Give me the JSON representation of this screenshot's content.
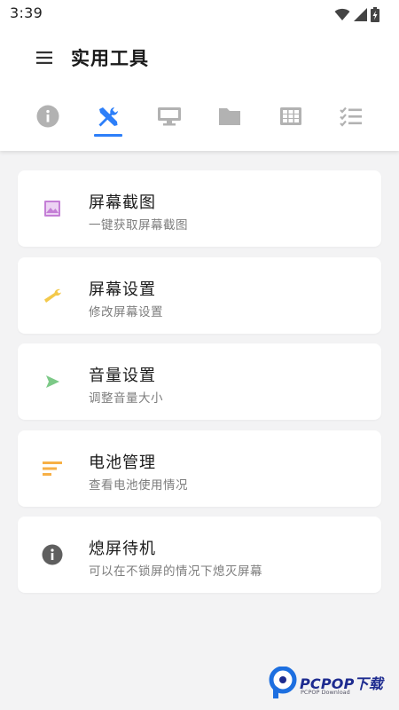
{
  "status_bar": {
    "time": "3:39",
    "icons": [
      "wifi-icon",
      "signal-icon",
      "battery-charging-icon"
    ]
  },
  "app_bar": {
    "menu_icon": "menu-icon",
    "title": "实用工具"
  },
  "tabs": [
    {
      "icon": "info-icon",
      "selected": false
    },
    {
      "icon": "tools-icon",
      "selected": true
    },
    {
      "icon": "monitor-icon",
      "selected": false
    },
    {
      "icon": "folder-icon",
      "selected": false
    },
    {
      "icon": "grid-icon",
      "selected": false
    },
    {
      "icon": "checklist-icon",
      "selected": false
    }
  ],
  "colors": {
    "accent": "#2d7ff9",
    "tab_inactive": "#b2b2b2",
    "screenshot_icon": "#c47fd6",
    "wrench_icon": "#f3c94b",
    "volume_icon": "#7cc987",
    "battery_icon": "#f7b046",
    "info_icon": "#5f5f5f"
  },
  "items": [
    {
      "icon": "image-icon",
      "title": "屏幕截图",
      "subtitle": "一键获取屏幕截图"
    },
    {
      "icon": "wrench-icon",
      "title": "屏幕设置",
      "subtitle": "修改屏幕设置"
    },
    {
      "icon": "play-arrow-icon",
      "title": "音量设置",
      "subtitle": "调整音量大小"
    },
    {
      "icon": "sort-lines-icon",
      "title": "电池管理",
      "subtitle": "查看电池使用情况"
    },
    {
      "icon": "info-icon",
      "title": "熄屏待机",
      "subtitle": "可以在不锁屏的情况下熄灭屏幕"
    }
  ],
  "watermark": {
    "text": "PCPOP下载",
    "subtext": "PCPOP Download"
  }
}
